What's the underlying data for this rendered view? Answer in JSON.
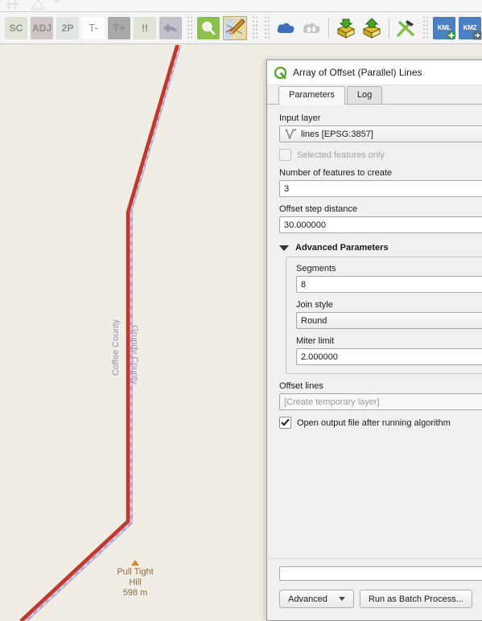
{
  "toolbar": {
    "buttons": [
      {
        "name": "sc-button",
        "label": "SC"
      },
      {
        "name": "adj-button",
        "label": "ADJ"
      },
      {
        "name": "2p-button",
        "label": "2P"
      },
      {
        "name": "t-minus-button",
        "label": "T-"
      },
      {
        "name": "t-plus-button",
        "label": "T+"
      },
      {
        "name": "warning-button",
        "label": "!!"
      }
    ],
    "kml_label": "KML",
    "kmz_label": "KMZ"
  },
  "map": {
    "county_left": "Coffee County",
    "county_right": "Grundy County",
    "peak_name_line1": "Pull Tight",
    "peak_name_line2": "Hill",
    "peak_elevation": "598 m",
    "background_color": "#f1ede4",
    "line_color": "#c0392b",
    "boundary_color": "#b9a8cc",
    "label_color": "#a08fb5",
    "peak_label_color": "#8a6b49",
    "peak_marker_color": "#cc8b34"
  },
  "dialog": {
    "title": "Array of Offset (Parallel) Lines",
    "tabs": [
      {
        "label": "Parameters",
        "active": true
      },
      {
        "label": "Log",
        "active": false
      }
    ],
    "fields": {
      "input_layer_label": "Input layer",
      "input_layer_value": "lines [EPSG:3857]",
      "selected_features_label": "Selected features only",
      "selected_features_checked": false,
      "num_features_label": "Number of features to create",
      "num_features_value": "3",
      "offset_step_label": "Offset step distance",
      "offset_step_value": "30.000000",
      "advanced_title": "Advanced Parameters",
      "segments_label": "Segments",
      "segments_value": "8",
      "join_style_label": "Join style",
      "join_style_value": "Round",
      "miter_limit_label": "Miter limit",
      "miter_limit_value": "2.000000",
      "offset_lines_label": "Offset lines",
      "offset_lines_placeholder": "[Create temporary layer]",
      "open_output_label": "Open output file after running algorithm",
      "open_output_checked": true
    },
    "footer": {
      "advanced_button": "Advanced",
      "batch_button": "Run as Batch Process..."
    }
  }
}
